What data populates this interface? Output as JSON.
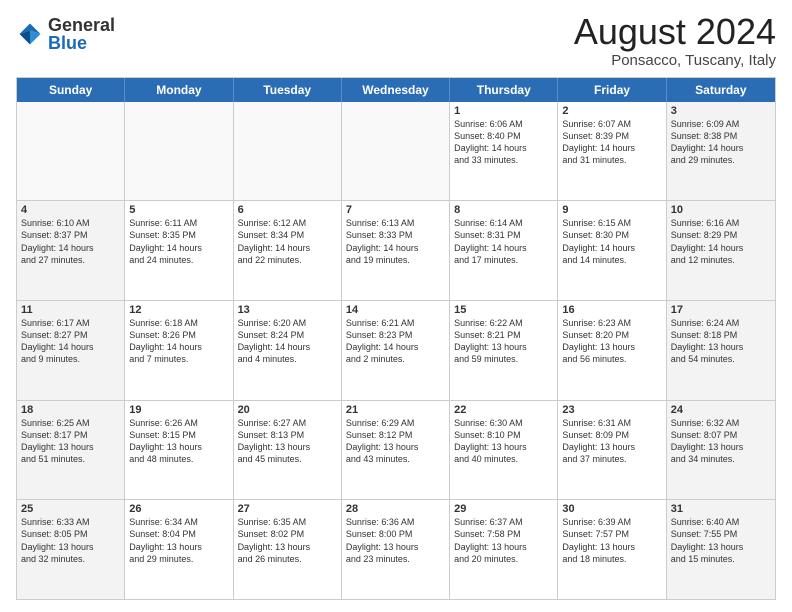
{
  "header": {
    "logo_general": "General",
    "logo_blue": "Blue",
    "title": "August 2024",
    "location": "Ponsacco, Tuscany, Italy"
  },
  "calendar": {
    "weekdays": [
      "Sunday",
      "Monday",
      "Tuesday",
      "Wednesday",
      "Thursday",
      "Friday",
      "Saturday"
    ],
    "rows": [
      [
        {
          "day": "",
          "info": "",
          "empty": true
        },
        {
          "day": "",
          "info": "",
          "empty": true
        },
        {
          "day": "",
          "info": "",
          "empty": true
        },
        {
          "day": "",
          "info": "",
          "empty": true
        },
        {
          "day": "1",
          "info": "Sunrise: 6:06 AM\nSunset: 8:40 PM\nDaylight: 14 hours\nand 33 minutes.",
          "empty": false
        },
        {
          "day": "2",
          "info": "Sunrise: 6:07 AM\nSunset: 8:39 PM\nDaylight: 14 hours\nand 31 minutes.",
          "empty": false
        },
        {
          "day": "3",
          "info": "Sunrise: 6:09 AM\nSunset: 8:38 PM\nDaylight: 14 hours\nand 29 minutes.",
          "empty": false,
          "shaded": true
        }
      ],
      [
        {
          "day": "4",
          "info": "Sunrise: 6:10 AM\nSunset: 8:37 PM\nDaylight: 14 hours\nand 27 minutes.",
          "empty": false,
          "shaded": true
        },
        {
          "day": "5",
          "info": "Sunrise: 6:11 AM\nSunset: 8:35 PM\nDaylight: 14 hours\nand 24 minutes.",
          "empty": false
        },
        {
          "day": "6",
          "info": "Sunrise: 6:12 AM\nSunset: 8:34 PM\nDaylight: 14 hours\nand 22 minutes.",
          "empty": false
        },
        {
          "day": "7",
          "info": "Sunrise: 6:13 AM\nSunset: 8:33 PM\nDaylight: 14 hours\nand 19 minutes.",
          "empty": false
        },
        {
          "day": "8",
          "info": "Sunrise: 6:14 AM\nSunset: 8:31 PM\nDaylight: 14 hours\nand 17 minutes.",
          "empty": false
        },
        {
          "day": "9",
          "info": "Sunrise: 6:15 AM\nSunset: 8:30 PM\nDaylight: 14 hours\nand 14 minutes.",
          "empty": false
        },
        {
          "day": "10",
          "info": "Sunrise: 6:16 AM\nSunset: 8:29 PM\nDaylight: 14 hours\nand 12 minutes.",
          "empty": false,
          "shaded": true
        }
      ],
      [
        {
          "day": "11",
          "info": "Sunrise: 6:17 AM\nSunset: 8:27 PM\nDaylight: 14 hours\nand 9 minutes.",
          "empty": false,
          "shaded": true
        },
        {
          "day": "12",
          "info": "Sunrise: 6:18 AM\nSunset: 8:26 PM\nDaylight: 14 hours\nand 7 minutes.",
          "empty": false
        },
        {
          "day": "13",
          "info": "Sunrise: 6:20 AM\nSunset: 8:24 PM\nDaylight: 14 hours\nand 4 minutes.",
          "empty": false
        },
        {
          "day": "14",
          "info": "Sunrise: 6:21 AM\nSunset: 8:23 PM\nDaylight: 14 hours\nand 2 minutes.",
          "empty": false
        },
        {
          "day": "15",
          "info": "Sunrise: 6:22 AM\nSunset: 8:21 PM\nDaylight: 13 hours\nand 59 minutes.",
          "empty": false
        },
        {
          "day": "16",
          "info": "Sunrise: 6:23 AM\nSunset: 8:20 PM\nDaylight: 13 hours\nand 56 minutes.",
          "empty": false
        },
        {
          "day": "17",
          "info": "Sunrise: 6:24 AM\nSunset: 8:18 PM\nDaylight: 13 hours\nand 54 minutes.",
          "empty": false,
          "shaded": true
        }
      ],
      [
        {
          "day": "18",
          "info": "Sunrise: 6:25 AM\nSunset: 8:17 PM\nDaylight: 13 hours\nand 51 minutes.",
          "empty": false,
          "shaded": true
        },
        {
          "day": "19",
          "info": "Sunrise: 6:26 AM\nSunset: 8:15 PM\nDaylight: 13 hours\nand 48 minutes.",
          "empty": false
        },
        {
          "day": "20",
          "info": "Sunrise: 6:27 AM\nSunset: 8:13 PM\nDaylight: 13 hours\nand 45 minutes.",
          "empty": false
        },
        {
          "day": "21",
          "info": "Sunrise: 6:29 AM\nSunset: 8:12 PM\nDaylight: 13 hours\nand 43 minutes.",
          "empty": false
        },
        {
          "day": "22",
          "info": "Sunrise: 6:30 AM\nSunset: 8:10 PM\nDaylight: 13 hours\nand 40 minutes.",
          "empty": false
        },
        {
          "day": "23",
          "info": "Sunrise: 6:31 AM\nSunset: 8:09 PM\nDaylight: 13 hours\nand 37 minutes.",
          "empty": false
        },
        {
          "day": "24",
          "info": "Sunrise: 6:32 AM\nSunset: 8:07 PM\nDaylight: 13 hours\nand 34 minutes.",
          "empty": false,
          "shaded": true
        }
      ],
      [
        {
          "day": "25",
          "info": "Sunrise: 6:33 AM\nSunset: 8:05 PM\nDaylight: 13 hours\nand 32 minutes.",
          "empty": false,
          "shaded": true
        },
        {
          "day": "26",
          "info": "Sunrise: 6:34 AM\nSunset: 8:04 PM\nDaylight: 13 hours\nand 29 minutes.",
          "empty": false
        },
        {
          "day": "27",
          "info": "Sunrise: 6:35 AM\nSunset: 8:02 PM\nDaylight: 13 hours\nand 26 minutes.",
          "empty": false
        },
        {
          "day": "28",
          "info": "Sunrise: 6:36 AM\nSunset: 8:00 PM\nDaylight: 13 hours\nand 23 minutes.",
          "empty": false
        },
        {
          "day": "29",
          "info": "Sunrise: 6:37 AM\nSunset: 7:58 PM\nDaylight: 13 hours\nand 20 minutes.",
          "empty": false
        },
        {
          "day": "30",
          "info": "Sunrise: 6:39 AM\nSunset: 7:57 PM\nDaylight: 13 hours\nand 18 minutes.",
          "empty": false
        },
        {
          "day": "31",
          "info": "Sunrise: 6:40 AM\nSunset: 7:55 PM\nDaylight: 13 hours\nand 15 minutes.",
          "empty": false,
          "shaded": true
        }
      ]
    ]
  }
}
